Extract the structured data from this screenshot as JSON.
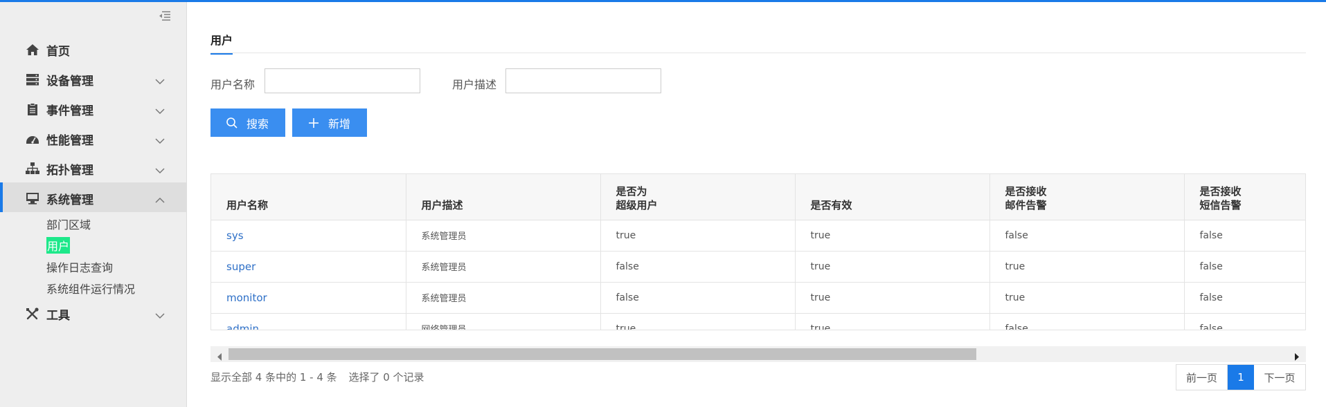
{
  "sidebar": {
    "items": [
      {
        "label": "首页",
        "icon": "home-icon"
      },
      {
        "label": "设备管理",
        "icon": "server-icon"
      },
      {
        "label": "事件管理",
        "icon": "clipboard-icon"
      },
      {
        "label": "性能管理",
        "icon": "dashboard-icon"
      },
      {
        "label": "拓扑管理",
        "icon": "sitemap-icon"
      },
      {
        "label": "系统管理",
        "icon": "desktop-icon"
      },
      {
        "label": "工具",
        "icon": "tools-icon"
      }
    ],
    "system_submenu": [
      "部门区域",
      "用户",
      "操作日志查询",
      "系统组件运行情况"
    ],
    "selected_submenu": "用户"
  },
  "tab": {
    "label": "用户"
  },
  "filters": {
    "username_label": "用户名称",
    "username_value": "",
    "description_label": "用户描述",
    "description_value": ""
  },
  "buttons": {
    "search": "搜索",
    "add": "新增"
  },
  "table": {
    "columns": [
      "用户名称",
      "用户描述",
      "是否为\n超级用户",
      "是否有效",
      "是否接收\n邮件告警",
      "是否接收\n短信告警"
    ],
    "rows": [
      [
        "sys",
        "系统管理员",
        "true",
        "true",
        "false",
        "false"
      ],
      [
        "super",
        "系统管理员",
        "false",
        "true",
        "true",
        "false"
      ],
      [
        "monitor",
        "系统管理员",
        "false",
        "true",
        "true",
        "false"
      ],
      [
        "admin",
        "网络管理员",
        "true",
        "true",
        "false",
        "false"
      ]
    ]
  },
  "status": {
    "summary": "显示全部 4 条中的 1 - 4 条",
    "selected": "选择了 0 个记录"
  },
  "pager": {
    "prev": "前一页",
    "current": "1",
    "next": "下一页"
  },
  "colors": {
    "accent": "#1a7ae8",
    "button": "#3a8ef0",
    "selected_highlight": "#1de88a"
  }
}
